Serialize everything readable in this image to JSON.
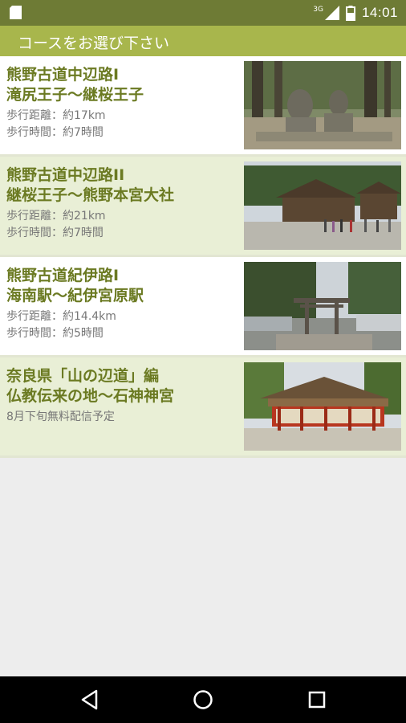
{
  "status": {
    "network": "3G",
    "time": "14:01"
  },
  "appbar": {
    "title": "コースをお選び下さい"
  },
  "courses": [
    {
      "title1": "熊野古道中辺路I",
      "title2": "滝尻王子～継桜王子",
      "line1": "歩行距離：約17km",
      "line2": "歩行時間：約7時間",
      "image": "stone-statues-forest-photo"
    },
    {
      "title1": "熊野古道中辺路II",
      "title2": "継桜王子～熊野本宮大社",
      "line1": "歩行距離：約21km",
      "line2": "歩行時間：約7時間",
      "image": "hongu-taisha-shrine-photo"
    },
    {
      "title1": "熊野古道紀伊路I",
      "title2": "海南駅～紀伊宮原駅",
      "line1": "歩行距離：約14.4km",
      "line2": "歩行時間：約5時間",
      "image": "torii-gate-photo"
    },
    {
      "title1": "奈良県「山の辺道」編",
      "title2": "仏教伝来の地～石神神宮",
      "line1": "8月下旬無料配信予定",
      "line2": "",
      "image": "red-shrine-photo"
    }
  ],
  "colors": {
    "statusbar": "#6e7b35",
    "appbar": "#a8b64c",
    "title_text": "#6b7a22",
    "row_tint": "#e9efd6"
  }
}
